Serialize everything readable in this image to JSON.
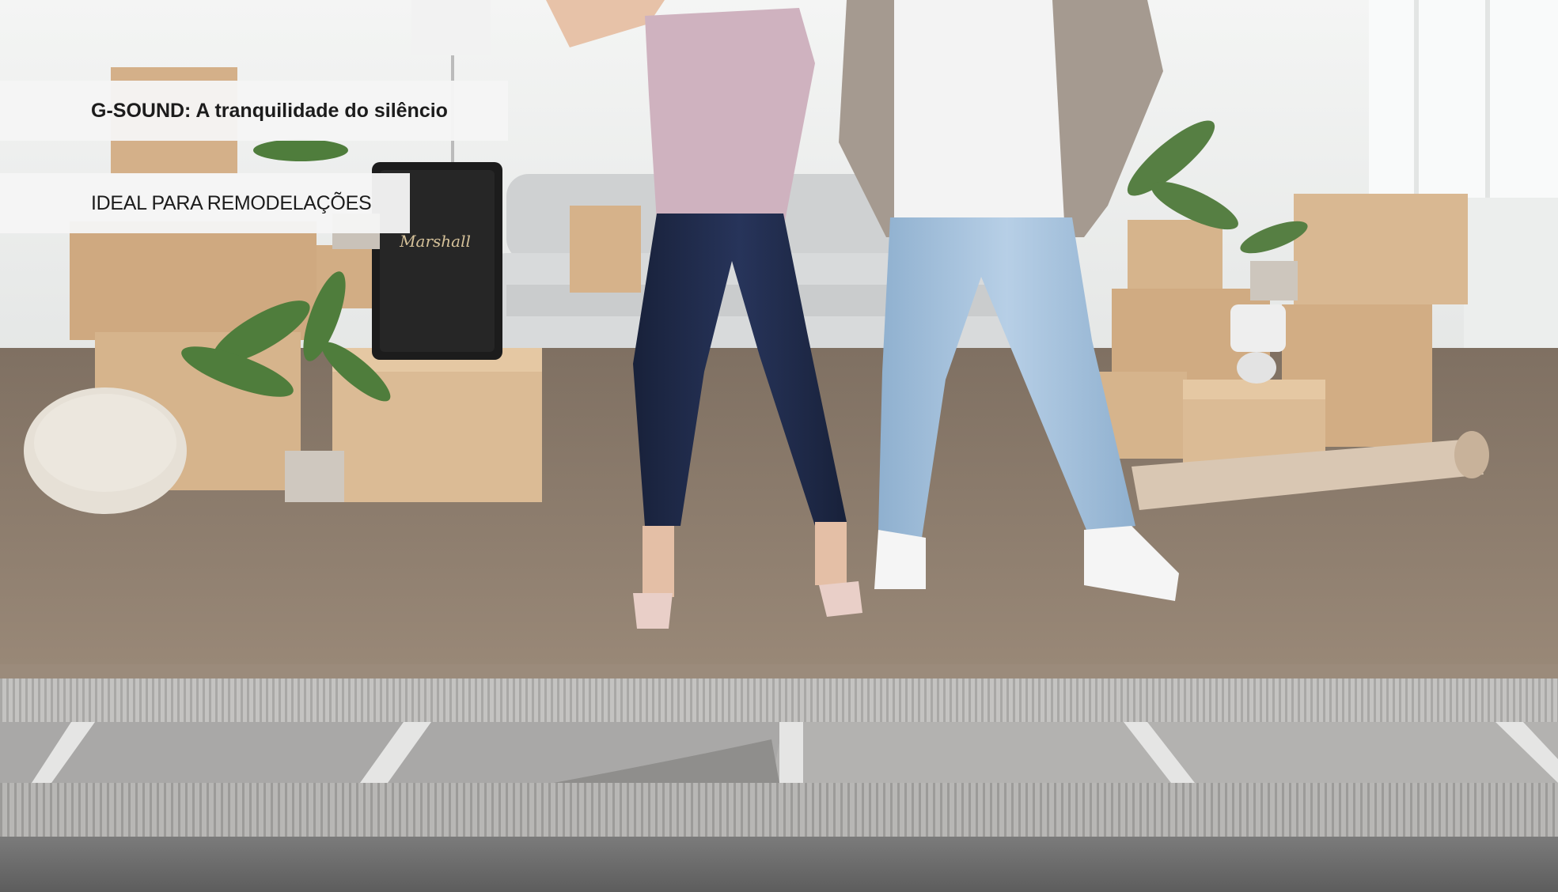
{
  "banner": {
    "title": "G-SOUND: A tranquilidade do silêncio",
    "subtitle": "IDEAL PARA REMODELAÇÕES"
  },
  "photo": {
    "speaker_brand_text": "Marshall",
    "colors": {
      "wall": "#eef0ef",
      "floor": "#8d7c6c",
      "cardboard": "#d6b48c",
      "membrane": "#c9c8c6",
      "subfloor": "#6e6e6e",
      "jeans_dark": "#1f2a48",
      "jeans_light": "#a9c4de",
      "top_pink": "#cfb2bf"
    }
  }
}
